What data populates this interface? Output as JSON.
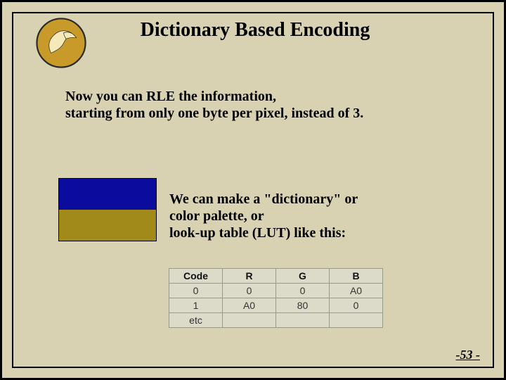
{
  "title": "Dictionary Based Encoding",
  "paragraph1": "Now you can RLE the information,\nstarting from only one byte per pixel, instead of 3.",
  "paragraph2": "We can make a \"dictionary\" or\ncolor palette, or\nlook-up table (LUT) like this:",
  "swatch": {
    "top_color": "#0b0b9e",
    "bottom_color": "#a28a1a"
  },
  "lut": {
    "headers": [
      "Code",
      "R",
      "G",
      "B"
    ],
    "rows": [
      [
        "0",
        "0",
        "0",
        "A0"
      ],
      [
        "1",
        "A0",
        "80",
        "0"
      ],
      [
        "etc",
        "",
        "",
        ""
      ]
    ]
  },
  "page_number": "-53 -",
  "logo_name": "ucf-pegasus-logo"
}
